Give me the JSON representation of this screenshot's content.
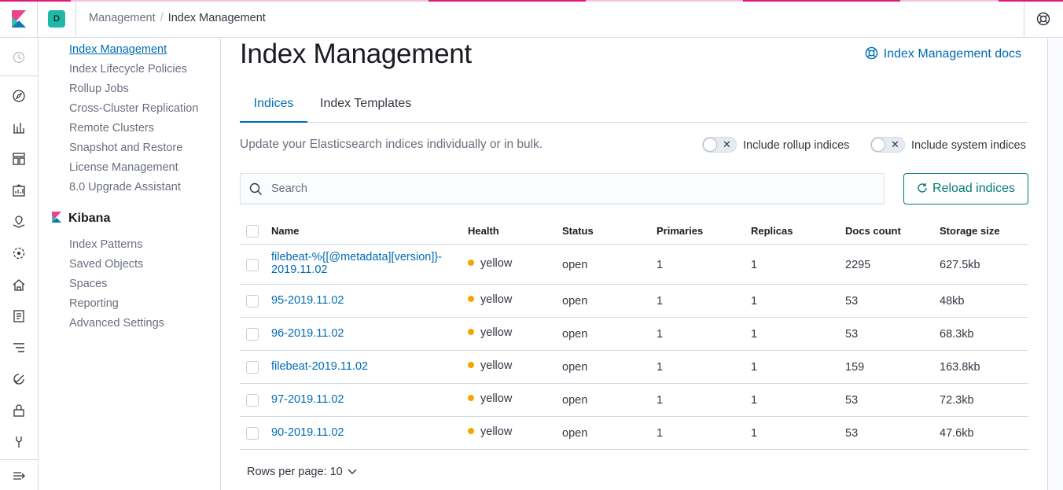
{
  "header": {
    "space_initial": "D",
    "breadcrumbs": [
      "Management",
      "Index Management"
    ],
    "breadcrumb_separator": "/"
  },
  "rail": {
    "icons": [
      "clock-icon",
      "compass-icon",
      "visualize-icon",
      "dashboard-icon",
      "canvas-icon",
      "maps-icon",
      "ml-icon",
      "infra-icon",
      "logs-icon",
      "apm-icon",
      "uptime-icon",
      "siem-icon",
      "devtools-icon",
      "collapse-icon"
    ]
  },
  "sidenav": {
    "elasticsearch_items": [
      "Index Management",
      "Index Lifecycle Policies",
      "Rollup Jobs",
      "Cross-Cluster Replication",
      "Remote Clusters",
      "Snapshot and Restore",
      "License Management",
      "8.0 Upgrade Assistant"
    ],
    "kibana_group": "Kibana",
    "kibana_items": [
      "Index Patterns",
      "Saved Objects",
      "Spaces",
      "Reporting",
      "Advanced Settings"
    ]
  },
  "main": {
    "title": "Index Management",
    "docs_link": "Index Management docs",
    "tabs": [
      "Indices",
      "Index Templates"
    ],
    "description": "Update your Elasticsearch indices individually or in bulk.",
    "toggle_rollup": "Include rollup indices",
    "toggle_system": "Include system indices",
    "toggle_off_glyph": "✕",
    "search_placeholder": "Search",
    "reload_label": "Reload indices",
    "columns": [
      "Name",
      "Health",
      "Status",
      "Primaries",
      "Replicas",
      "Docs count",
      "Storage size"
    ],
    "rows": [
      {
        "name_line1": "filebeat-%{[@metadata][version]}-",
        "name_line2": "2019.11.02",
        "health": "yellow",
        "status": "open",
        "primaries": "1",
        "replicas": "1",
        "docs": "2295",
        "size": "627.5kb"
      },
      {
        "name_line1": "95-2019.11.02",
        "name_line2": "",
        "health": "yellow",
        "status": "open",
        "primaries": "1",
        "replicas": "1",
        "docs": "53",
        "size": "48kb"
      },
      {
        "name_line1": "96-2019.11.02",
        "name_line2": "",
        "health": "yellow",
        "status": "open",
        "primaries": "1",
        "replicas": "1",
        "docs": "53",
        "size": "68.3kb"
      },
      {
        "name_line1": "filebeat-2019.11.02",
        "name_line2": "",
        "health": "yellow",
        "status": "open",
        "primaries": "1",
        "replicas": "1",
        "docs": "159",
        "size": "163.8kb"
      },
      {
        "name_line1": "97-2019.11.02",
        "name_line2": "",
        "health": "yellow",
        "status": "open",
        "primaries": "1",
        "replicas": "1",
        "docs": "53",
        "size": "72.3kb"
      },
      {
        "name_line1": "90-2019.11.02",
        "name_line2": "",
        "health": "yellow",
        "status": "open",
        "primaries": "1",
        "replicas": "1",
        "docs": "53",
        "size": "47.6kb"
      }
    ],
    "rows_per_page": "Rows per page: 10"
  },
  "colors": {
    "accent": "#006bb4",
    "health_yellow": "#f5a700",
    "reload_green": "#017d73",
    "loading_pink": "#e0187a"
  }
}
